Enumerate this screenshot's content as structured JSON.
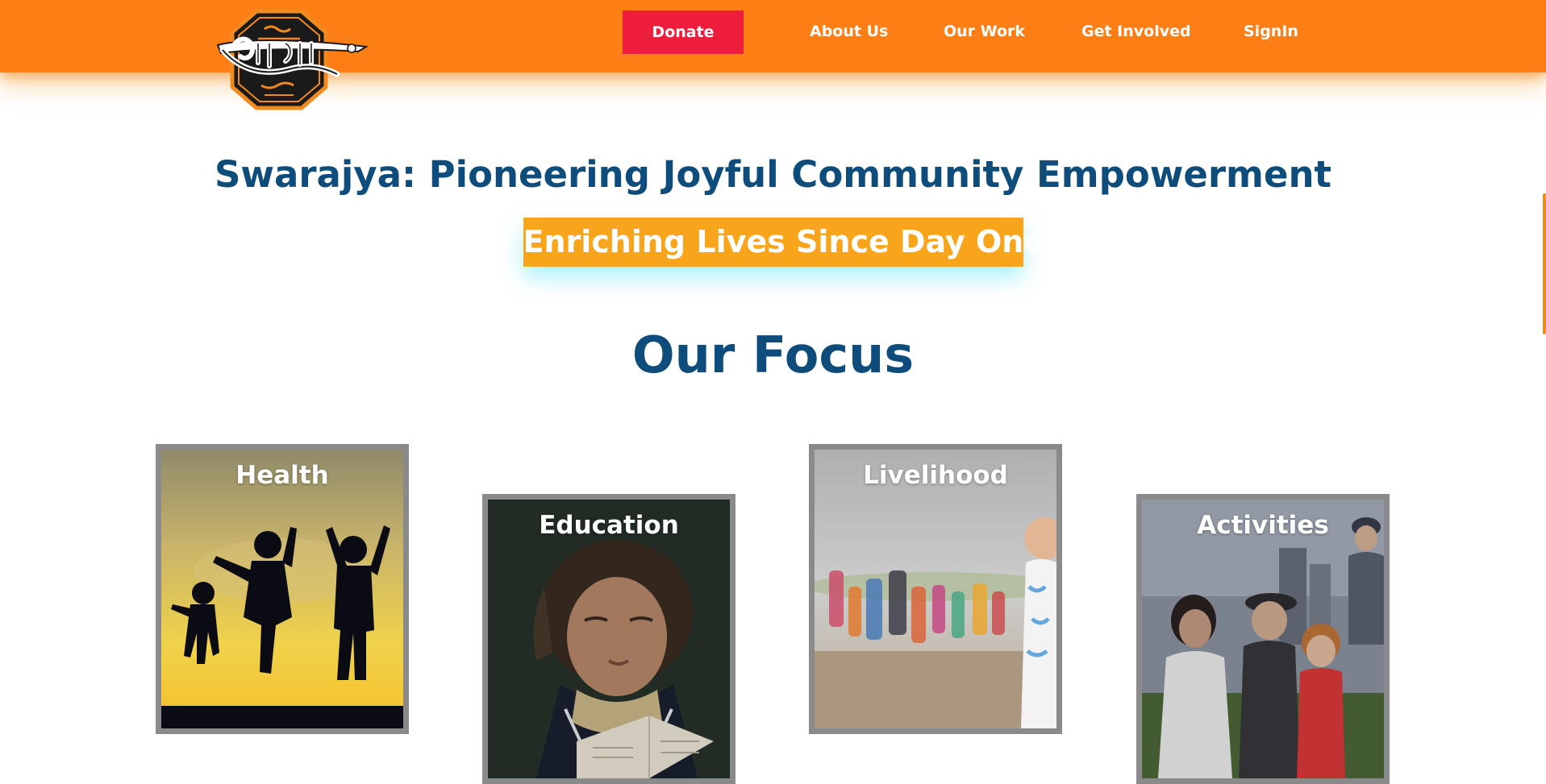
{
  "header": {
    "logo_alt": "Swarajya logo",
    "nav": {
      "donate": "Donate",
      "about": "About Us",
      "work": "Our Work",
      "involved": "Get Involved",
      "signin": "SignIn"
    }
  },
  "hero": {
    "title": "Swarajya: Pioneering Joyful Community Empowerment",
    "tagline": "Enriching Lives Since Day One"
  },
  "focus": {
    "title": "Our Focus",
    "cards": [
      {
        "label": "Health"
      },
      {
        "label": "Education"
      },
      {
        "label": "Livelihood"
      },
      {
        "label": "Activities"
      }
    ]
  },
  "colors": {
    "header_bg": "#fd7e14",
    "donate_bg": "#ee1d3b",
    "heading": "#0e4c7c",
    "badge_bg": "#f8a51b"
  }
}
